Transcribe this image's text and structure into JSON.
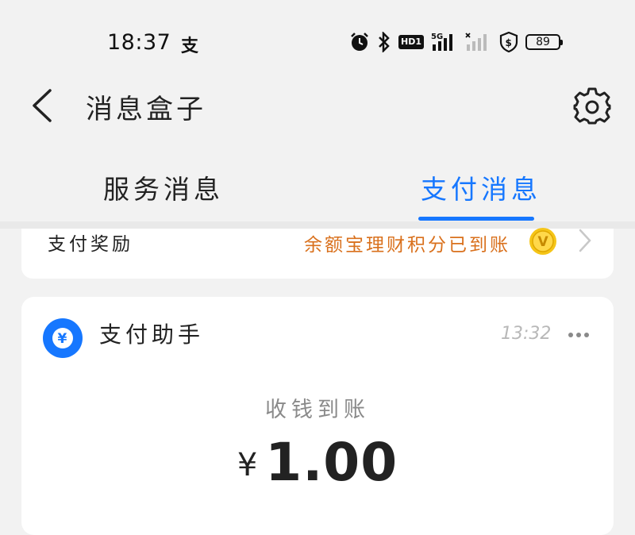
{
  "status_bar": {
    "time": "18:37",
    "alipay_glyph": "支",
    "hd_label": "HD1",
    "network_label": "5G",
    "battery": "89"
  },
  "nav": {
    "title": "消息盒子",
    "back_icon": "chevron-left-icon",
    "settings_icon": "gear-icon"
  },
  "tabs": [
    {
      "label": "服务消息",
      "active": false
    },
    {
      "label": "支付消息",
      "active": true
    }
  ],
  "reward_card": {
    "title": "支付奖励",
    "message": "余额宝理财积分已到账",
    "coin_glyph": "V"
  },
  "assistant_card": {
    "name": "支付助手",
    "avatar_glyph": "¥",
    "time": "13:32",
    "label": "收钱到账",
    "currency": "¥",
    "amount": "1.00"
  },
  "colors": {
    "accent": "#1677ff",
    "reward_text": "#d9701c",
    "background": "#f2f2f2"
  }
}
